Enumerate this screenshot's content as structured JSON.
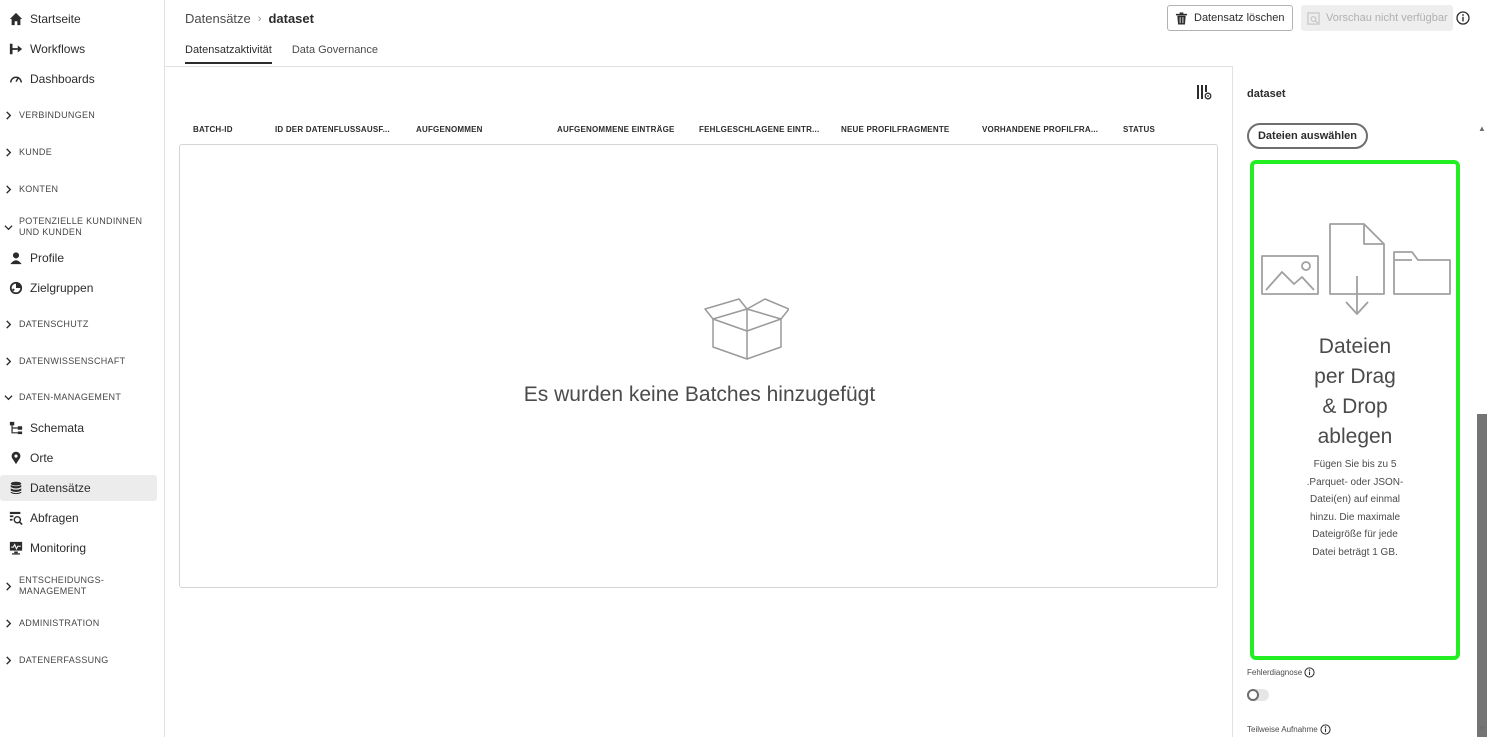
{
  "sidebar": {
    "items": [
      {
        "label": "Startseite",
        "icon": "home-icon"
      },
      {
        "label": "Workflows",
        "icon": "workflow-icon"
      },
      {
        "label": "Dashboards",
        "icon": "dashboard-icon"
      },
      {
        "label": "VERBINDUNGEN",
        "type": "section"
      },
      {
        "label": "KUNDE",
        "type": "section"
      },
      {
        "label": "KONTEN",
        "type": "section"
      },
      {
        "label": "POTENZIELLE KUNDINNEN UND KUNDEN",
        "type": "section",
        "expanded": true
      },
      {
        "label": "Profile",
        "icon": "user-icon"
      },
      {
        "label": "Zielgruppen",
        "icon": "segment-icon"
      },
      {
        "label": "DATENSCHUTZ",
        "type": "section"
      },
      {
        "label": "DATENWISSENSCHAFT",
        "type": "section"
      },
      {
        "label": "DATEN-MANAGEMENT",
        "type": "section",
        "expanded": true
      },
      {
        "label": "Schemata",
        "icon": "schema-icon"
      },
      {
        "label": "Orte",
        "icon": "location-pin-icon"
      },
      {
        "label": "Datensätze",
        "icon": "database-icon",
        "active": true
      },
      {
        "label": "Abfragen",
        "icon": "query-icon"
      },
      {
        "label": "Monitoring",
        "icon": "monitoring-icon"
      },
      {
        "label": "ENTSCHEIDUNGS-MANAGEMENT",
        "type": "section"
      },
      {
        "label": "ADMINISTRATION",
        "type": "section"
      },
      {
        "label": "DATENERFASSUNG",
        "type": "section"
      }
    ]
  },
  "header": {
    "breadcrumb_parent": "Datensätze",
    "breadcrumb_current": "dataset",
    "tabs": [
      {
        "label": "Datensatzaktivität",
        "active": true
      },
      {
        "label": "Data Governance",
        "active": false
      }
    ],
    "delete_button": "Datensatz löschen",
    "preview_button": "Vorschau nicht verfügbar"
  },
  "table": {
    "columns": [
      "BATCH-ID",
      "ID DER DATENFLUSSAUSF...",
      "AUFGENOMMEN",
      "AUFGENOMMENE EINTRÄGE",
      "FEHLGESCHLAGENE EINTR...",
      "NEUE PROFILFRAGMENTE",
      "VORHANDENE PROFILFRA...",
      "STATUS"
    ],
    "empty_message": "Es wurden keine Batches hinzugefügt"
  },
  "panel": {
    "title": "dataset",
    "choose_files_button": "Dateien auswählen",
    "dropzone_heading": "Dateien per Drag & Drop ablegen",
    "dropzone_text": "Fügen Sie bis zu 5 .Parquet- oder JSON-Datei(en) auf einmal hinzu. Die maximale Dateigröße für jede Datei beträgt 1 GB.",
    "error_diagnostics_label": "Fehlerdiagnose",
    "partial_ingestion_label": "Teilweise Aufnahme",
    "error_diagnostics_enabled": false,
    "highlight_color": "#22ee22"
  }
}
